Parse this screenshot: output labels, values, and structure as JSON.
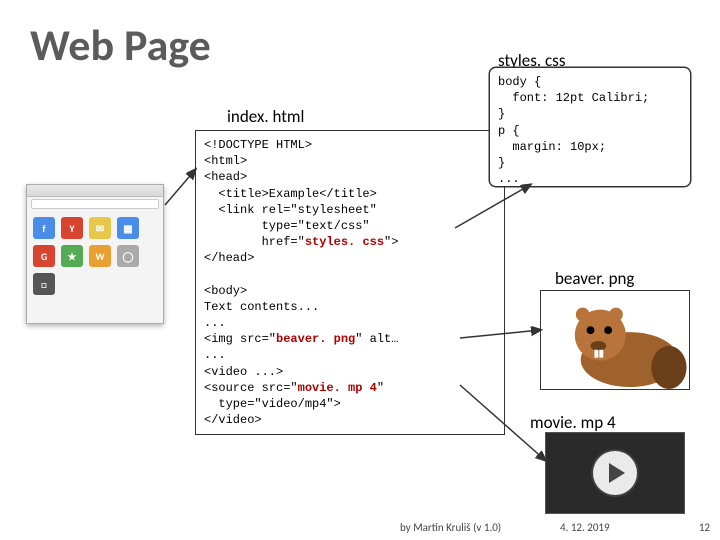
{
  "title": "Web Page",
  "labels": {
    "index": "index. html",
    "styles": "styles. css",
    "beaver": "beaver. png",
    "movie": "movie. mp 4"
  },
  "index_code": {
    "l1": "<!DOCTYPE HTML>",
    "l2": "<html>",
    "l3": "<head>",
    "l4": "  <title>Example</title>",
    "l5": "  <link rel=\"stylesheet\"",
    "l6": "        type=\"text/css\"",
    "l7a": "        href=\"",
    "l7b": "styles. css",
    "l7c": "\">",
    "l8": "</head>",
    "l9": "",
    "l10": "<body>",
    "l11": "Text contents...",
    "l12": "...",
    "l13a": "<img src=\"",
    "l13b": "beaver. png",
    "l13c": "\" alt…",
    "l14": "...",
    "l15": "<video ...>",
    "l16a": "<source src=\"",
    "l16b": "movie. mp 4",
    "l16c": "\"",
    "l17": "  type=\"video/mp4\">",
    "l18": "</video>"
  },
  "css_code": {
    "l1": "body {",
    "l2": "  font: 12pt Calibri;",
    "l3": "}",
    "l4": "p {",
    "l5": "  margin: 10px;",
    "l6": "}",
    "l7": "..."
  },
  "footer": {
    "by": "by Martin Kruliš (v 1.0)",
    "date": "4. 12. 2019",
    "num": "12"
  }
}
